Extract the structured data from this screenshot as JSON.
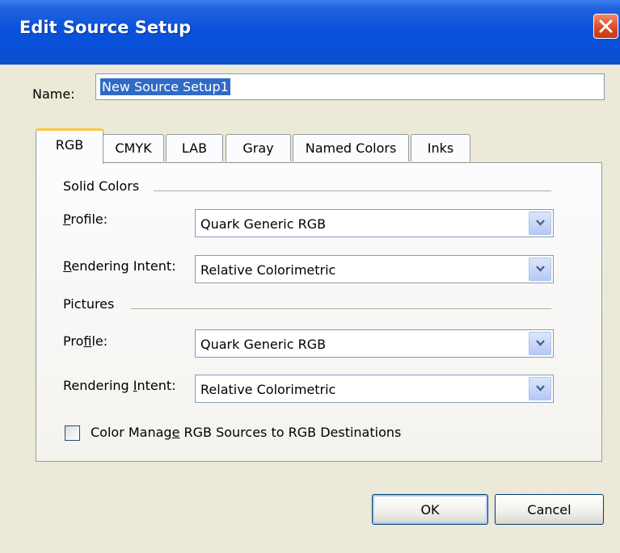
{
  "window": {
    "title": "Edit Source Setup",
    "close_icon": "close-icon"
  },
  "name": {
    "label": "Name:",
    "value": "New Source Setup1"
  },
  "tabs": [
    {
      "label": "RGB",
      "active": true
    },
    {
      "label": "CMYK",
      "active": false
    },
    {
      "label": "LAB",
      "active": false
    },
    {
      "label": "Gray",
      "active": false
    },
    {
      "label": "Named Colors",
      "active": false
    },
    {
      "label": "Inks",
      "active": false
    }
  ],
  "solid_colors": {
    "heading": "Solid Colors",
    "profile_label": {
      "pre": "",
      "u": "P",
      "post": "rofile:"
    },
    "profile_value": "Quark Generic RGB",
    "intent_label": {
      "pre": "",
      "u": "R",
      "post": "endering Intent:"
    },
    "intent_value": "Relative Colorimetric"
  },
  "pictures": {
    "heading": "Pictures",
    "profile_label": {
      "pre": "Pro",
      "u": "f",
      "post": "ile:"
    },
    "profile_value": "Quark Generic RGB",
    "intent_label": {
      "pre": "Rendering ",
      "u": "I",
      "post": "ntent:"
    },
    "intent_value": "Relative Colorimetric"
  },
  "checkbox": {
    "checked": false,
    "label": {
      "pre": "Color Manag",
      "u": "e",
      "post": " RGB Sources to RGB Destinations"
    }
  },
  "buttons": {
    "ok": "OK",
    "cancel": "Cancel"
  }
}
